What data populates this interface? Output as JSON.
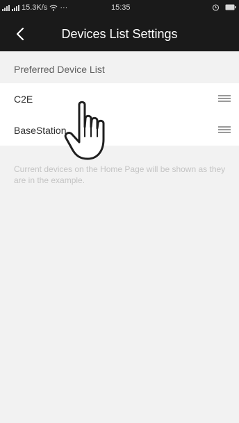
{
  "status_bar": {
    "network_text": "15.3K/s",
    "dots": "···",
    "time": "15:35",
    "alarm_icon": "alarm-icon",
    "battery_icon": "battery-icon"
  },
  "header": {
    "title": "Devices List Settings",
    "back_icon": "chevron-left-icon"
  },
  "section": {
    "title": "Preferred Device List"
  },
  "devices": [
    {
      "label": "C2E",
      "handle_icon": "drag-handle-icon"
    },
    {
      "label": "BaseStation",
      "handle_icon": "drag-handle-icon"
    }
  ],
  "hint": "Current devices on the Home Page will be shown as they are in the example.",
  "overlay": {
    "icon": "hand-pointer-icon"
  },
  "colors": {
    "header_bg": "#1a1a1a",
    "page_bg": "#f2f2f2",
    "row_bg": "#ffffff",
    "hint_text": "#c4c4c4"
  }
}
